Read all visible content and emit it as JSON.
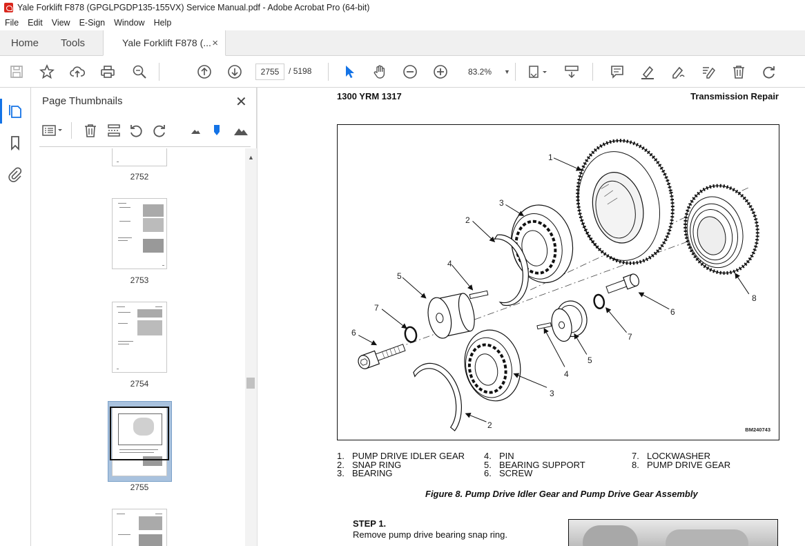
{
  "window": {
    "title": "Yale Forklift F878 (GPGLPGDP135-155VX) Service Manual.pdf - Adobe Acrobat Pro (64-bit)"
  },
  "menu": [
    "File",
    "Edit",
    "View",
    "E-Sign",
    "Window",
    "Help"
  ],
  "tabs": {
    "home": "Home",
    "tools": "Tools",
    "document": "Yale Forklift F878 (...",
    "close_glyph": "×"
  },
  "toolbar": {
    "current_page": "2755",
    "page_separator": "/",
    "total_pages": "5198",
    "zoom": "83.2%"
  },
  "panel": {
    "title": "Page Thumbnails",
    "close_glyph": "✕",
    "thumbnails": [
      {
        "label": "2752"
      },
      {
        "label": "2753"
      },
      {
        "label": "2754"
      },
      {
        "label": "2755",
        "selected": true
      },
      {
        "label": ""
      }
    ]
  },
  "page": {
    "header_left": "1300 YRM 1317",
    "header_right": "Transmission Repair",
    "figure": {
      "code": "BM240743",
      "callouts": [
        "1",
        "2",
        "3",
        "4",
        "5",
        "6",
        "7",
        "8",
        "2",
        "3",
        "4",
        "5",
        "6",
        "7"
      ]
    },
    "legend_col1": [
      {
        "num": "1.",
        "text": "PUMP DRIVE IDLER GEAR"
      },
      {
        "num": "2.",
        "text": "SNAP RING"
      },
      {
        "num": "3.",
        "text": "BEARING"
      }
    ],
    "legend_col2": [
      {
        "num": "4.",
        "text": "PIN"
      },
      {
        "num": "5.",
        "text": "BEARING SUPPORT"
      },
      {
        "num": "6.",
        "text": "SCREW"
      }
    ],
    "legend_col3": [
      {
        "num": "7.",
        "text": "LOCKWASHER"
      },
      {
        "num": "8.",
        "text": "PUMP DRIVE GEAR"
      }
    ],
    "caption": "Figure 8. Pump Drive Idler Gear and Pump Drive Gear Assembly",
    "step_title": "STEP 1.",
    "step_text": "Remove pump drive bearing snap ring."
  }
}
